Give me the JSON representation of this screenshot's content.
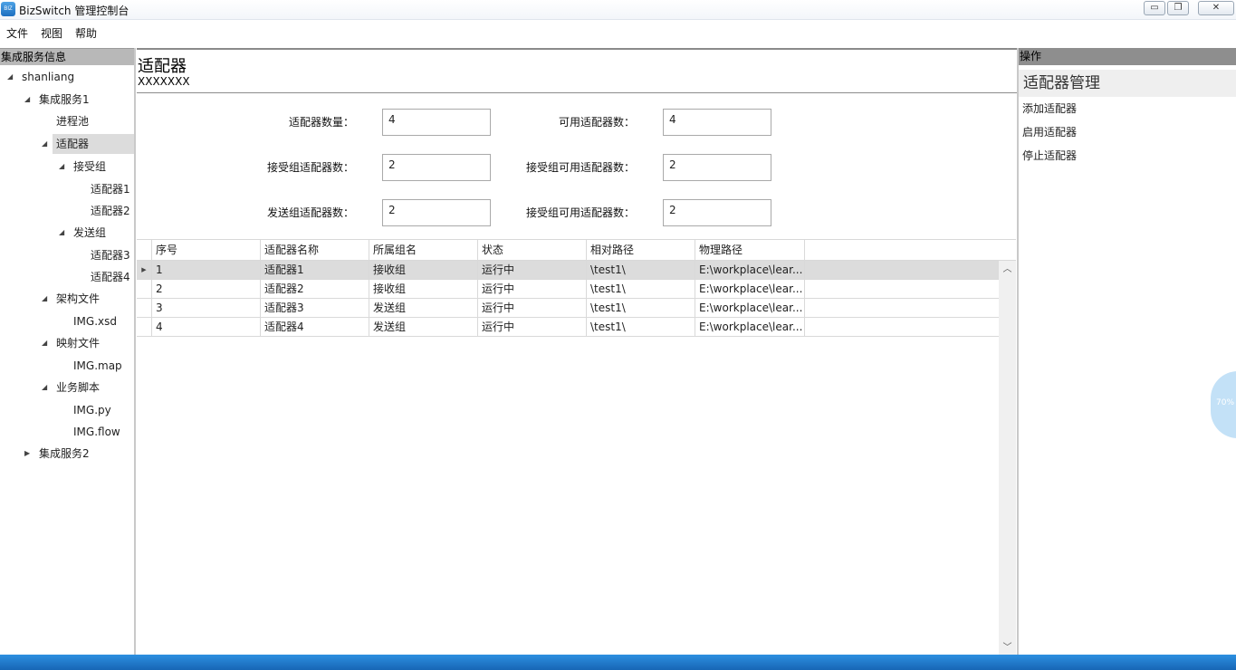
{
  "window": {
    "icon_text": "BIZ",
    "title": "BizSwitch 管理控制台",
    "min_glyph": "▭",
    "max_glyph": "❐",
    "close_glyph": "✕"
  },
  "menu": [
    "文件",
    "视图",
    "帮助"
  ],
  "left_panel": {
    "header": "集成服务信息",
    "tree": [
      {
        "label": "shanliang",
        "arrow": "◢"
      },
      {
        "label": "集成服务1",
        "arrow": "◢"
      },
      {
        "label": "进程池",
        "arrow": ""
      },
      {
        "label": "适配器",
        "arrow": "◢"
      },
      {
        "label": "接受组",
        "arrow": "◢"
      },
      {
        "label": "适配器1",
        "arrow": ""
      },
      {
        "label": "适配器2",
        "arrow": ""
      },
      {
        "label": "发送组",
        "arrow": "◢"
      },
      {
        "label": "适配器3",
        "arrow": ""
      },
      {
        "label": "适配器4",
        "arrow": ""
      },
      {
        "label": "架构文件",
        "arrow": "◢"
      },
      {
        "label": "IMG.xsd",
        "arrow": ""
      },
      {
        "label": "映射文件",
        "arrow": "◢"
      },
      {
        "label": "IMG.map",
        "arrow": ""
      },
      {
        "label": "业务脚本",
        "arrow": "◢"
      },
      {
        "label": "IMG.py",
        "arrow": ""
      },
      {
        "label": "IMG.flow",
        "arrow": ""
      },
      {
        "label": "集成服务2",
        "arrow": "▶"
      }
    ]
  },
  "center": {
    "title": "适配器",
    "subtitle": "XXXXXXX",
    "stats": [
      {
        "label": "适配器数量：",
        "value": "4"
      },
      {
        "label": "可用适配器数：",
        "value": "4"
      },
      {
        "label": "接受组适配器数：",
        "value": "2"
      },
      {
        "label": "接受组可用适配器数：",
        "value": "2"
      },
      {
        "label": "发送组适配器数：",
        "value": "2"
      },
      {
        "label": "接受组可用适配器数：",
        "value": "2"
      }
    ],
    "grid": {
      "columns": [
        "序号",
        "适配器名称",
        "所属组名",
        "状态",
        "相对路径",
        "物理路径"
      ],
      "current_row_glyph": "▶",
      "rows": [
        [
          "1",
          "适配器1",
          "接收组",
          "运行中",
          "\\test1\\",
          "E:\\workplace\\lear..."
        ],
        [
          "2",
          "适配器2",
          "接收组",
          "运行中",
          "\\test1\\",
          "E:\\workplace\\lear..."
        ],
        [
          "3",
          "适配器3",
          "发送组",
          "运行中",
          "\\test1\\",
          "E:\\workplace\\lear..."
        ],
        [
          "4",
          "适配器4",
          "发送组",
          "运行中",
          "\\test1\\",
          "E:\\workplace\\lear..."
        ]
      ],
      "scroll_up_glyph": "︿",
      "scroll_down_glyph": "﹀"
    }
  },
  "right_panel": {
    "header": "操作",
    "section": "适配器管理",
    "actions": [
      "添加适配器",
      "启用适配器",
      "停止适配器"
    ]
  },
  "float_badge": "70%"
}
